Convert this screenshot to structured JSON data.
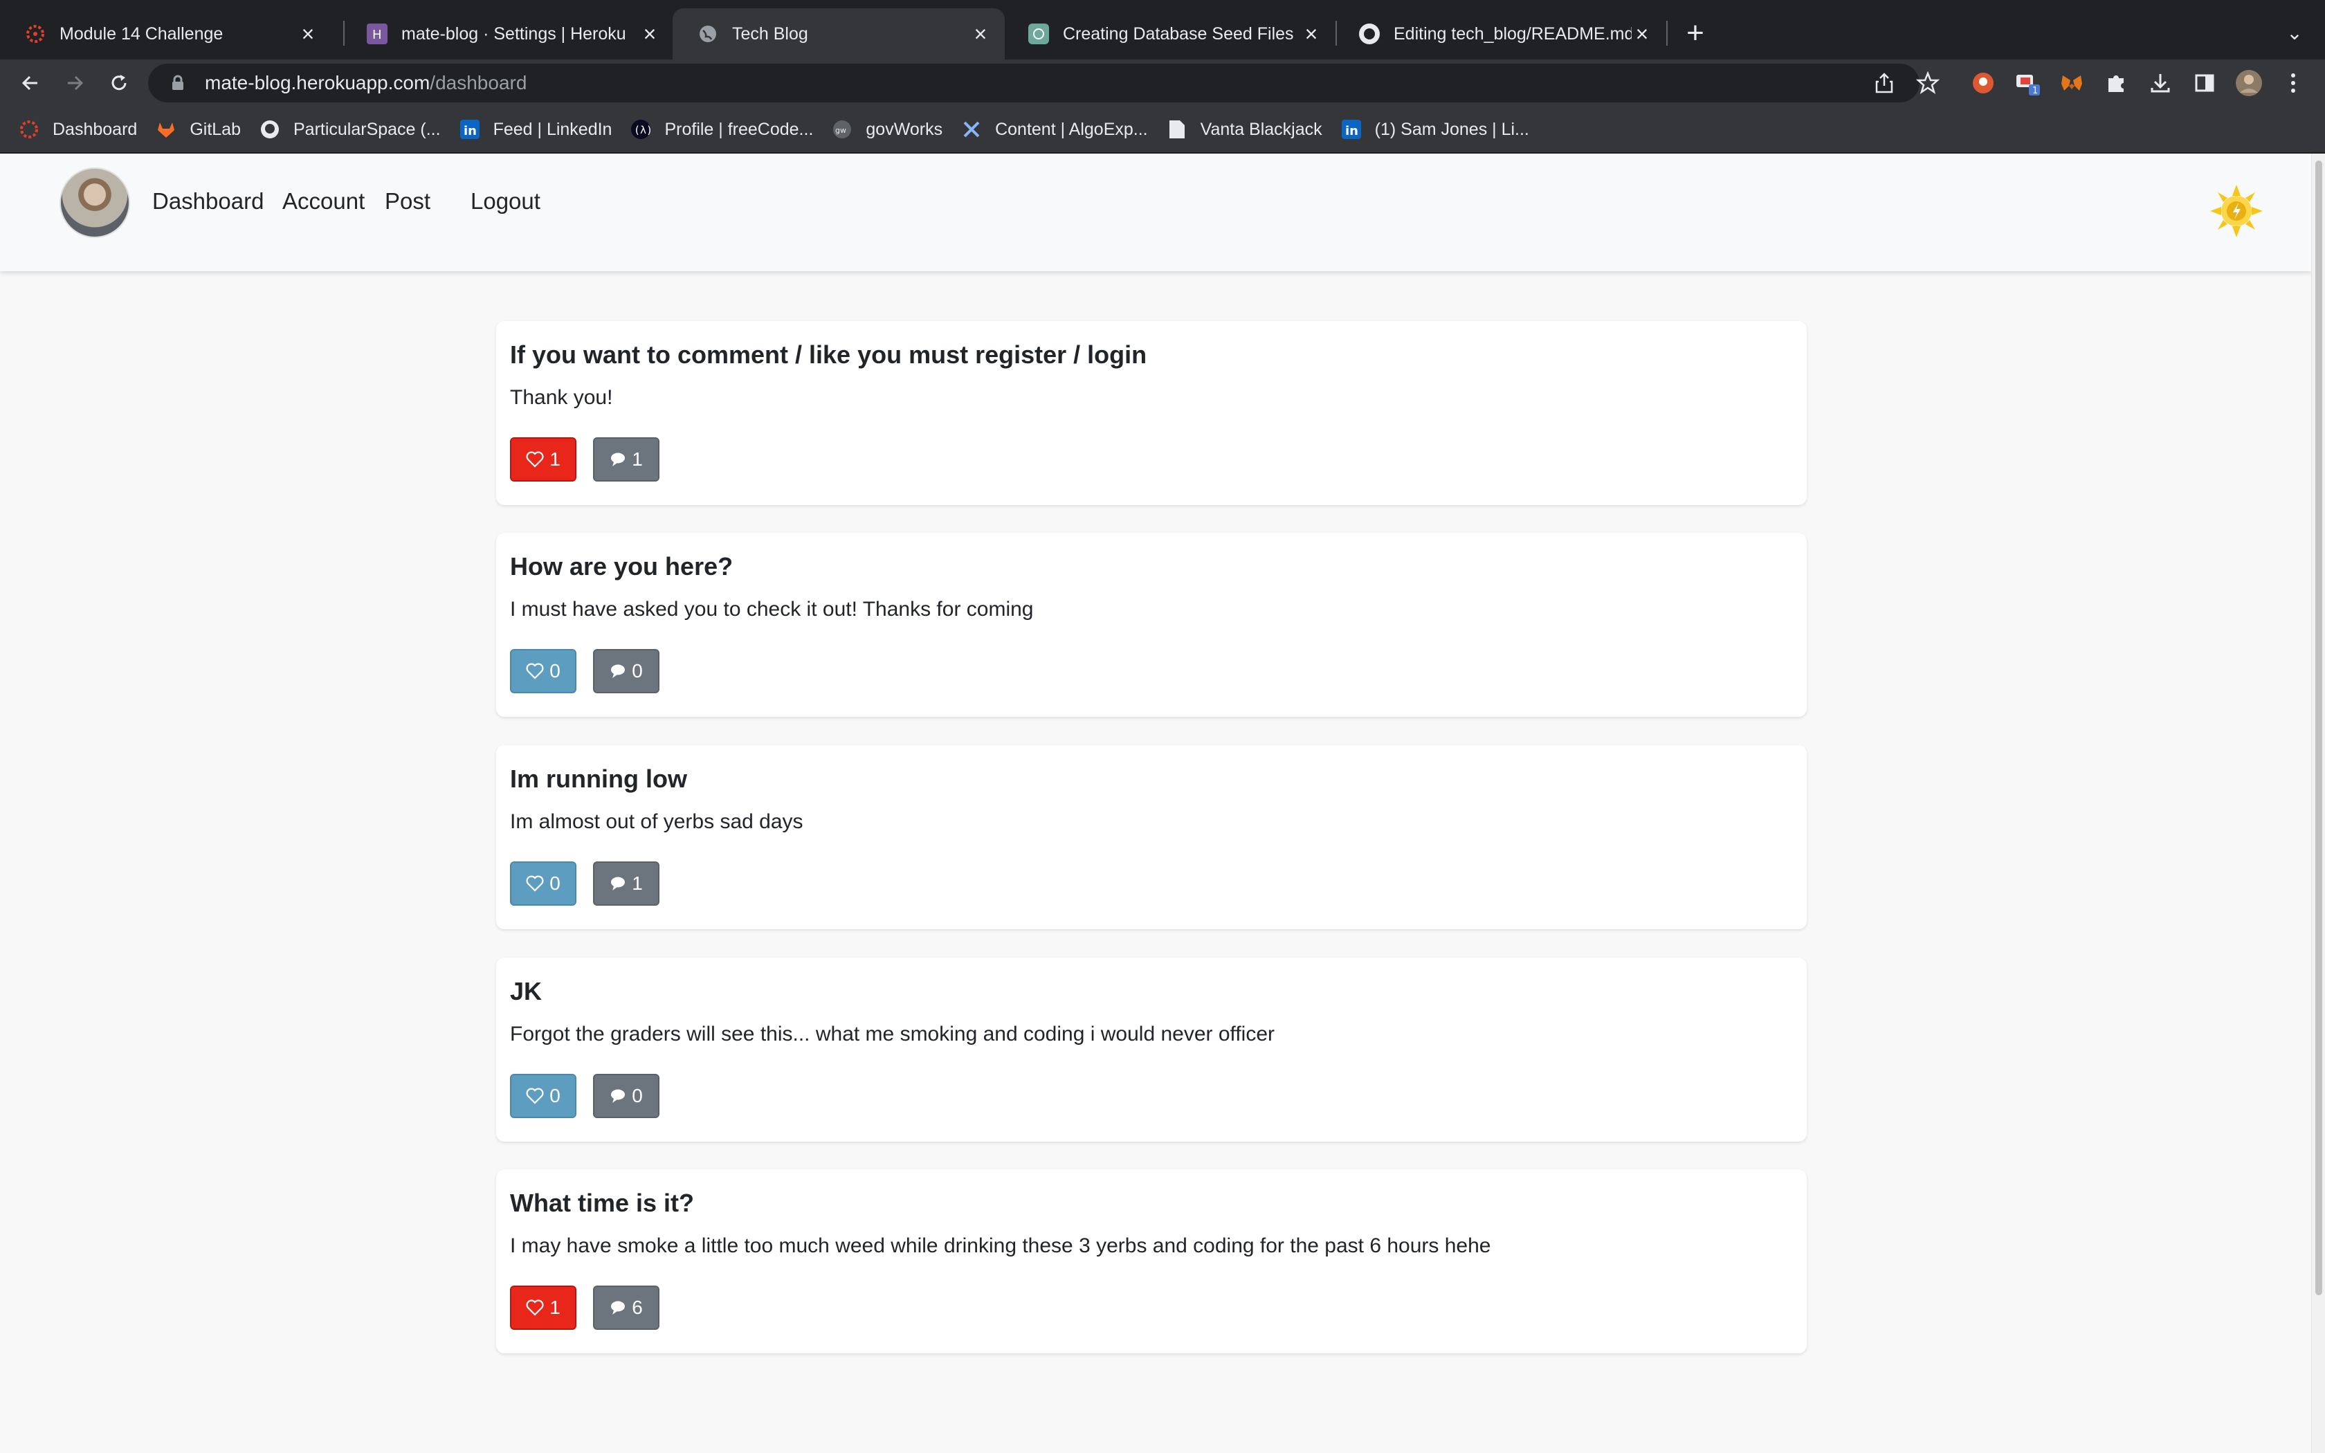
{
  "browser": {
    "tabs": [
      {
        "title": "Module 14 Challenge",
        "icon": "canvas-icon",
        "active": false
      },
      {
        "title": "mate-blog · Settings | Heroku",
        "icon": "heroku-icon",
        "active": false
      },
      {
        "title": "Tech Blog",
        "icon": "globe-icon",
        "active": true
      },
      {
        "title": "Creating Database Seed Files",
        "icon": "chatgpt-icon",
        "active": false
      },
      {
        "title": "Editing tech_blog/README.md",
        "icon": "github-icon",
        "active": false
      }
    ],
    "url_host": "mate-blog.herokuapp.com",
    "url_path": "/dashboard",
    "extension_badge": "1",
    "bookmarks": [
      {
        "label": "Dashboard",
        "icon": "canvas-icon"
      },
      {
        "label": "GitLab",
        "icon": "gitlab-icon"
      },
      {
        "label": "ParticularSpace (...",
        "icon": "github-icon"
      },
      {
        "label": "Feed | LinkedIn",
        "icon": "linkedin-icon"
      },
      {
        "label": "Profile | freeCode...",
        "icon": "freecodecamp-icon"
      },
      {
        "label": "govWorks",
        "icon": "govworks-icon"
      },
      {
        "label": "Content | AlgoExp...",
        "icon": "algoexpert-icon"
      },
      {
        "label": "Vanta Blackjack",
        "icon": "document-icon"
      },
      {
        "label": "(1) Sam Jones | Li...",
        "icon": "linkedin-icon"
      }
    ]
  },
  "site": {
    "nav": {
      "dashboard": "Dashboard",
      "account": "Account",
      "post": "Post",
      "logout": "Logout"
    },
    "posts": [
      {
        "title": "If you want to comment / like you must register / login",
        "body": "Thank you!",
        "likes": "1",
        "comments": "1",
        "liked": true
      },
      {
        "title": "How are you here?",
        "body": "I must have asked you to check it out! Thanks for coming",
        "likes": "0",
        "comments": "0",
        "liked": false
      },
      {
        "title": "Im running low",
        "body": "Im almost out of yerbs sad days",
        "likes": "0",
        "comments": "1",
        "liked": false
      },
      {
        "title": "JK",
        "body": "Forgot the graders will see this... what me smoking and coding i would never officer",
        "likes": "0",
        "comments": "0",
        "liked": false
      },
      {
        "title": "What time is it?",
        "body": "I may have smoke a little too much weed while drinking these 3 yerbs and coding for the past 6 hours hehe",
        "likes": "1",
        "comments": "6",
        "liked": true
      }
    ]
  },
  "colors": {
    "liked": "#e8261a",
    "unliked": "#5d9dc0",
    "comment": "#6c757d"
  }
}
